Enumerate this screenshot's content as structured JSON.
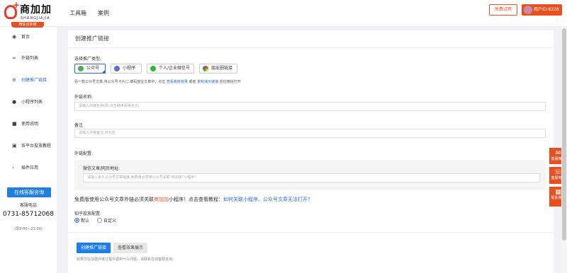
{
  "brand": {
    "name": "商加加",
    "sub": "SHANGJIAJIA"
  },
  "nav": {
    "tools": "工具箱",
    "cases": "案例"
  },
  "header": {
    "trial": "免费试用",
    "user": "用户ID:8228"
  },
  "sidebar": {
    "badge": "微信点外链",
    "items": [
      {
        "label": "首页"
      },
      {
        "label": "外链列表"
      },
      {
        "label": "创建推广链接"
      },
      {
        "label": "小程序列表"
      },
      {
        "label": "使用说明"
      },
      {
        "label": "各平台投放教程"
      },
      {
        "label": "插件应用"
      }
    ],
    "service_button": "在线客服咨询",
    "service_label": "客服电话",
    "phone": "0731-85712068",
    "hours": "(早9:00—21:00)"
  },
  "main": {
    "title": "创建推广链接",
    "type_label": "选择推广类型:",
    "types": [
      {
        "label": "公众号"
      },
      {
        "label": "小程序"
      },
      {
        "label": "个人/企业微信号"
      },
      {
        "label": "朋友圈链接"
      }
    ],
    "hint_text": "另一款公众号文章,将公众号卡片/二维码放在文章中；点击",
    "hint_link1": "查看跳转效果",
    "hint_or": "或者",
    "hint_link2": "复制演示链接",
    "hint_tail": "前往微信打开",
    "name_label": "外链名称:",
    "name_placeholder": "请输入外链名称(例:点击继续阅读全文)",
    "remark_label": "备注",
    "remark_placeholder": "请输入外链备注,可为空",
    "config_label": "外链配置:",
    "article_label": "微信文章/网页地址:",
    "article_placeholder": "请输入永久公众号文章链接,免费版必须用公众号关联\"商加加\"小程序!",
    "free_prefix": "免费版使用公众号文章外链必须关联",
    "free_red": "商加加",
    "free_mid": "小程序！点击查看教程：",
    "free_blue": "如何关联小程序、公众号文章无法打开?",
    "delivery_label": "知乎投放配置:",
    "radio_default": "默认",
    "radio_custom": "自定义",
    "create_button": "创建推广链接",
    "demo_button": "查看效果展示",
    "footnote": "如果您在创建外链过程中遇到什么问题，请联系在线客服咨询。"
  },
  "float": {
    "wechat": "客服微信",
    "phone": "客服电话",
    "qr": "联系我们"
  }
}
